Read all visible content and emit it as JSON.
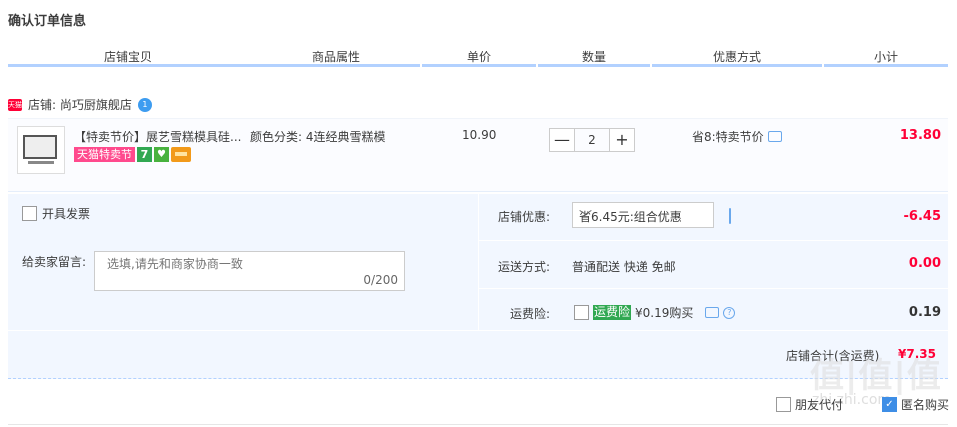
{
  "page": {
    "title": "确认订单信息"
  },
  "columns": [
    "店铺宝贝",
    "商品属性",
    "单价",
    "数量",
    "优惠方式",
    "小计"
  ],
  "shop": {
    "tag": "天猫",
    "label": "店铺: 尚巧厨旗舰店",
    "ww_icon": "1"
  },
  "item": {
    "title": "【特卖节价】展艺雪糕模具硅...",
    "badge_tmall": "天猫特卖节",
    "badge_7": "7",
    "badge_cert": "♥",
    "attr": "颜色分类: 4连经典雪糕模",
    "price": "10.90",
    "qty_minus": "—",
    "qty_value": "2",
    "qty_plus": "+",
    "promo": "省8:特卖节价",
    "subtotal": "13.80"
  },
  "panel": {
    "invoice_label": "开具发票",
    "message_label": "给卖家留言:",
    "message_placeholder": "选填,请先和商家协商一致",
    "message_count": "0/200",
    "shop_discount_label": "店铺优惠:",
    "shop_discount_select": "省6.45元:组合优惠",
    "shop_discount_amount": "-6.45",
    "shipping_label": "运送方式:",
    "shipping_value": "普通配送 快递 免邮",
    "shipping_amount": "0.00",
    "insurance_label": "运费险:",
    "insurance_tag": "运费险",
    "insurance_text": "¥0.19购买",
    "insurance_amount": "0.19"
  },
  "total": {
    "label": "店铺合计(含运费)",
    "value": "¥7.35"
  },
  "watermark": {
    "main": "值|值|值",
    "sub": "zhi.zhi.com"
  },
  "bottom": {
    "friend_pay": "朋友代付",
    "anonymous": "匿名购买"
  },
  "colors": {
    "price_red": "#ff0036",
    "header_line": "#b2d1ff",
    "panel_bg": "#f2f7ff"
  }
}
